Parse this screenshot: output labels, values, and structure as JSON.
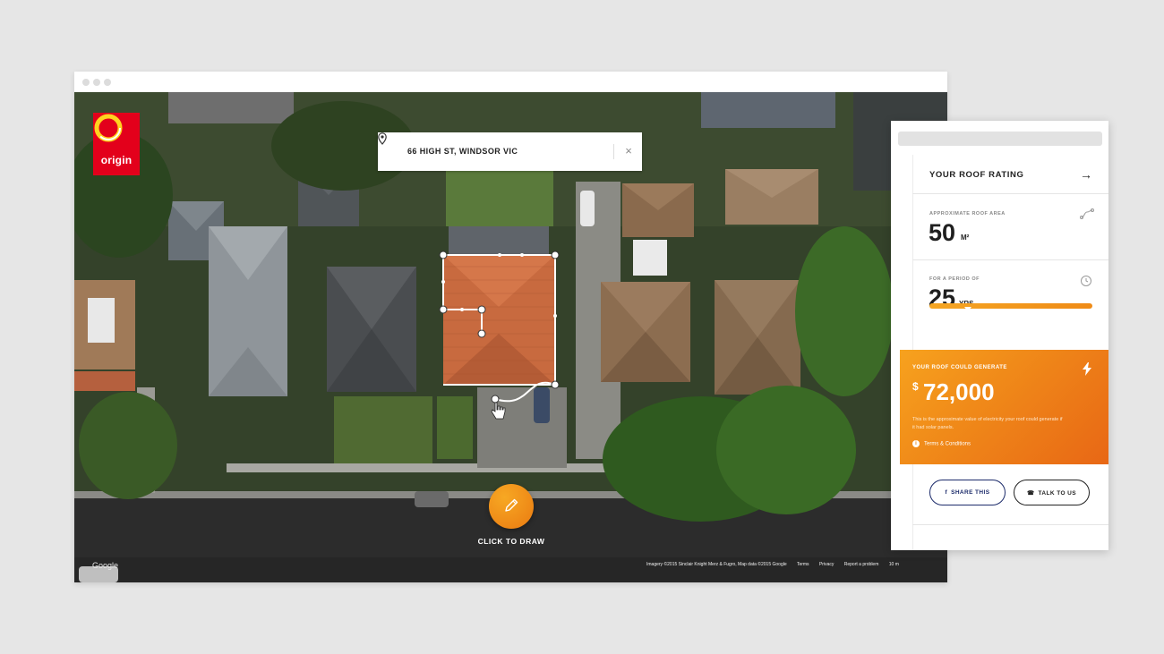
{
  "brand": {
    "name": "origin",
    "color": "#e3001b"
  },
  "search": {
    "value": "66 HIGH ST, WINDSOR VIC",
    "pin_icon": "location-pin-icon",
    "clear_icon": "close-icon",
    "clear_label": "×"
  },
  "map": {
    "draw_label": "CLICK TO DRAW",
    "draw_icon": "pencil-icon",
    "google_label": "Google",
    "attribution": [
      "Imagery ©2015 Sinclair Knight Merz & Fugro, Map data ©2015 Google",
      "Terms",
      "Privacy",
      "Report a problem",
      "10 m"
    ]
  },
  "panel": {
    "rating_title": "YOUR ROOF RATING",
    "rating_arrow": "→",
    "area": {
      "label": "APPROXIMATE ROOF AREA",
      "value": "50",
      "unit": "M²",
      "icon": "measure-path-icon"
    },
    "period": {
      "label": "FOR A PERIOD OF",
      "value": "25",
      "unit": "YRS",
      "icon": "history-clock-icon",
      "slider_fraction": 0.25
    },
    "generate": {
      "title": "YOUR ROOF COULD GENERATE",
      "currency": "$",
      "amount": "72,000",
      "description": "This is the approximate value of electricity your roof could generate if it had solar panels.",
      "terms": "Terms & Conditions",
      "bolt_icon": "lightning-bolt-icon"
    },
    "actions": {
      "share": "SHARE THIS",
      "talk": "TALK TO US"
    }
  },
  "colors": {
    "accent": "#f08a19",
    "brand_red": "#e3001b",
    "navy": "#1d2c6b"
  }
}
